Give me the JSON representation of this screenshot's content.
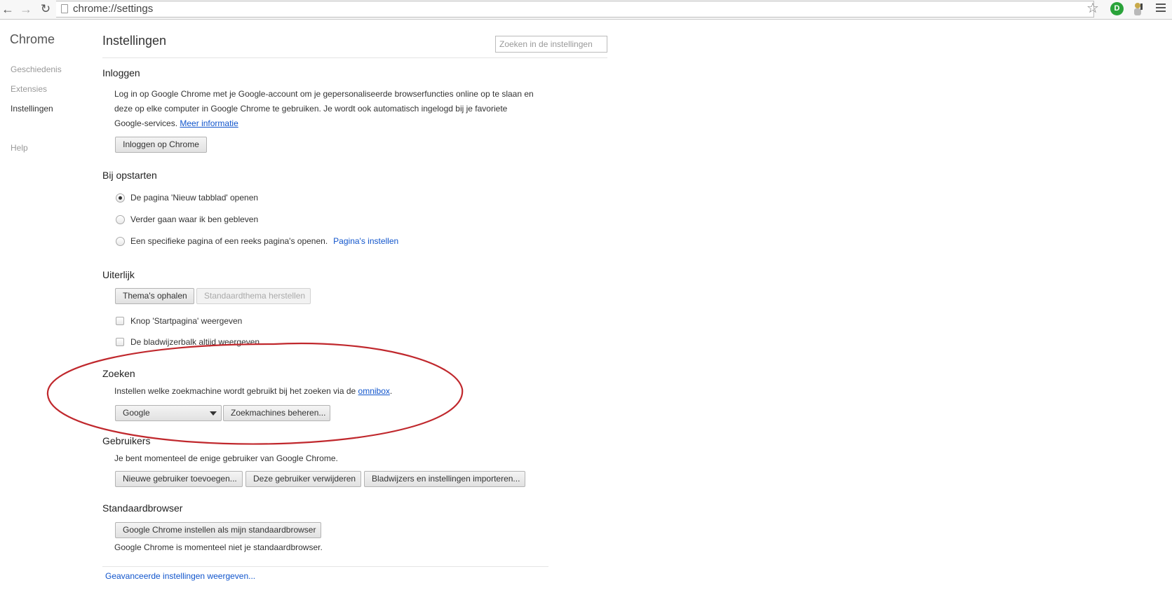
{
  "toolbar": {
    "url": "chrome://settings",
    "extension_badge": "D"
  },
  "sidebar": {
    "brand": "Chrome",
    "items": [
      {
        "label": "Geschiedenis"
      },
      {
        "label": "Extensies"
      },
      {
        "label": "Instellingen"
      },
      {
        "label": "Help"
      }
    ]
  },
  "header": {
    "title": "Instellingen",
    "search_placeholder": "Zoeken in de instellingen"
  },
  "signin": {
    "title": "Inloggen",
    "line1": "Log in op Google Chrome met je Google-account om je gepersonaliseerde browserfuncties online op te slaan en",
    "line2": "deze op elke computer in Google Chrome te gebruiken. Je wordt ook automatisch ingelogd bij je favoriete",
    "line3": "Google-services.",
    "learn_more": "Meer informatie",
    "button": "Inloggen op Chrome"
  },
  "startup": {
    "title": "Bij opstarten",
    "options": [
      {
        "label": "De pagina 'Nieuw tabblad' openen",
        "checked": true
      },
      {
        "label": "Verder gaan waar ik ben gebleven",
        "checked": false
      },
      {
        "label": "Een specifieke pagina of een reeks pagina's openen.",
        "checked": false
      }
    ],
    "set_pages_link": "Pagina's instellen"
  },
  "appearance": {
    "title": "Uiterlijk",
    "get_themes": "Thema's ophalen",
    "reset_theme": "Standaardthema herstellen",
    "show_home": "Knop 'Startpagina' weergeven",
    "show_bookmarks": "De bladwijzerbalk altijd weergeven"
  },
  "search": {
    "title": "Zoeken",
    "description": "Instellen welke zoekmachine wordt gebruikt bij het zoeken via de",
    "omnibox_link": "omnibox",
    "period": ".",
    "engine": "Google",
    "manage_button": "Zoekmachines beheren..."
  },
  "users": {
    "title": "Gebruikers",
    "description": "Je bent momenteel de enige gebruiker van Google Chrome.",
    "add_button": "Nieuwe gebruiker toevoegen...",
    "remove_button": "Deze gebruiker verwijderen",
    "import_button": "Bladwijzers en instellingen importeren..."
  },
  "default_browser": {
    "title": "Standaardbrowser",
    "button": "Google Chrome instellen als mijn standaardbrowser",
    "status": "Google Chrome is momenteel niet je standaardbrowser."
  },
  "advanced_link": "Geavanceerde instellingen weergeven...",
  "colors": {
    "link": "#1155cc",
    "annotation": "#c0282d",
    "extension_green": "#2aa33a"
  }
}
